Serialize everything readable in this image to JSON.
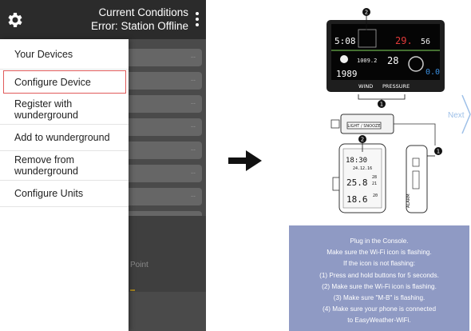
{
  "header": {
    "title": "Current Conditions",
    "subtitle": "Error: Station Offline"
  },
  "drawer": {
    "items": [
      {
        "label": "Your Devices"
      },
      {
        "label": "Configure Device",
        "selected": true
      },
      {
        "label": "Register with\nwunderground"
      },
      {
        "label": "Add to wunderground"
      },
      {
        "label": "Remove from\nwunderground"
      },
      {
        "label": "Configure Units"
      }
    ]
  },
  "background": {
    "row_value": "--",
    "point_label": "Point"
  },
  "console": {
    "time": "5:08",
    "indoor_temp": "29.",
    "indoor_hum": "56",
    "pressure_value": "1009.2",
    "outdoor_temp": "28",
    "rain_value": "0.0",
    "lower_value": "1989",
    "wind_label": "WIND",
    "pressure_label": "PRESSURE",
    "light_button_label": "LIGHT / SNOOZE",
    "alarm_label": "ALARM"
  },
  "sensor": {
    "time": "18:30",
    "date": "24.12.16",
    "temp": "25.8",
    "temp_small_1": "28",
    "temp_small_2": "21",
    "humidity": "18.6",
    "humidity_small": "20"
  },
  "callouts": {
    "one": "1",
    "two": "2"
  },
  "next_label": "Next",
  "instructions": {
    "lines": [
      "Plug in the Console.",
      "Make sure the Wi-Fi icon is flashing.",
      "If the icon is not flashing:",
      "(1) Press and hold buttons for 5 seconds.",
      "(2) Make sure the Wi-Fi icon is flashing.",
      "(3) Make sure \"M-B\" is flashing.",
      "(4) Make sure your phone is connected",
      "to EasyWeather-WiFi."
    ]
  },
  "colors": {
    "header_bg": "#2b2b2b",
    "selected_border": "#e05a5a",
    "info_bg": "#8f9ac4",
    "next_color": "#9ec0e8"
  }
}
